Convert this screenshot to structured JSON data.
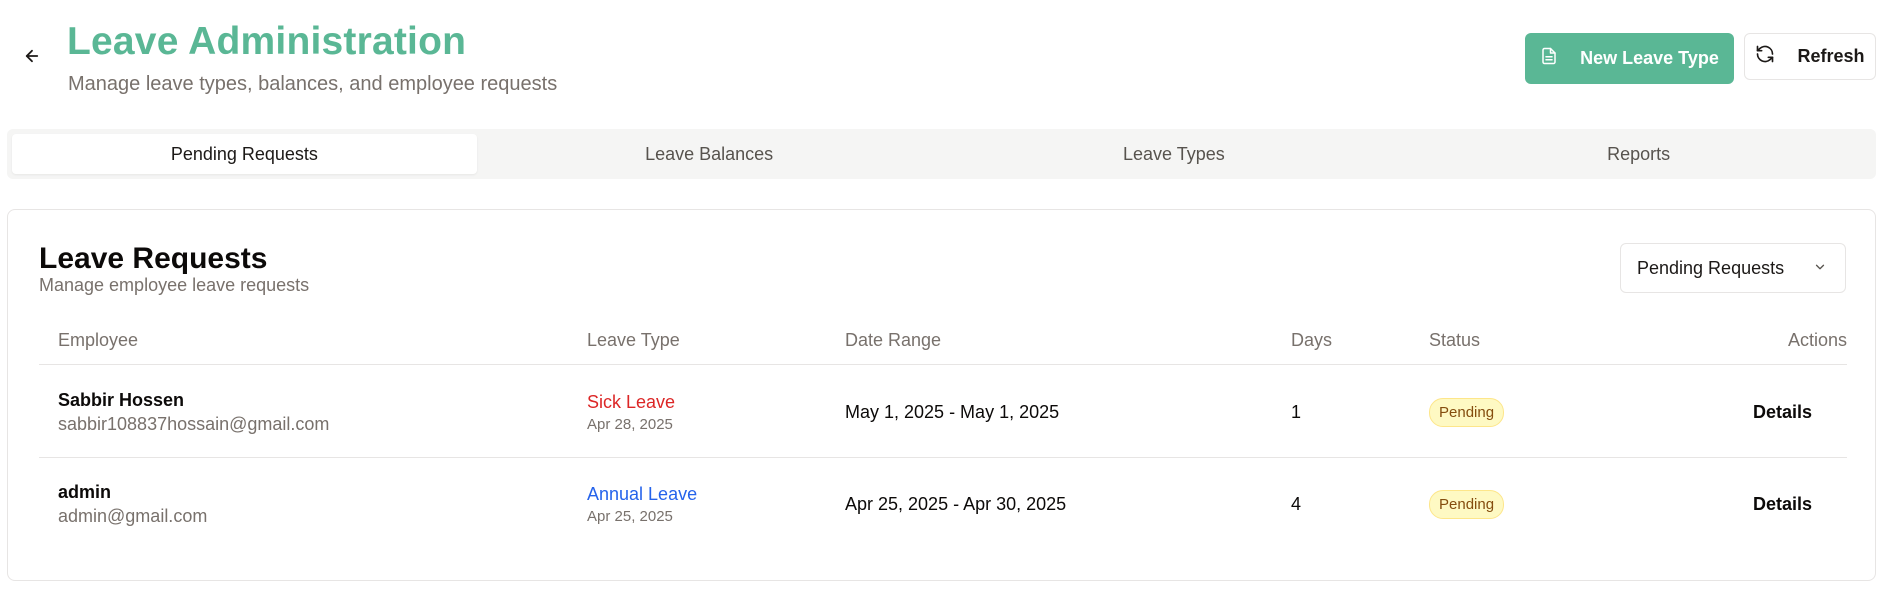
{
  "header": {
    "title": "Leave Administration",
    "subtitle": "Manage leave types, balances, and employee requests",
    "new_button_label": "New Leave Type",
    "refresh_button_label": "Refresh",
    "accent_color": "#5ab795"
  },
  "tabs": [
    {
      "label": "Pending Requests",
      "active": true
    },
    {
      "label": "Leave Balances",
      "active": false
    },
    {
      "label": "Leave Types",
      "active": false
    },
    {
      "label": "Reports",
      "active": false
    }
  ],
  "card": {
    "title": "Leave Requests",
    "subtitle": "Manage employee leave requests",
    "filter_value": "Pending Requests"
  },
  "table": {
    "columns": [
      "Employee",
      "Leave Type",
      "Date Range",
      "Days",
      "Status",
      "Actions"
    ],
    "rows": [
      {
        "name": "Sabbir Hossen",
        "email": "sabbir108837hossain@gmail.com",
        "leave_type": "Sick Leave",
        "leave_type_color": "#dc2626",
        "requested_on": "Apr 28, 2025",
        "date_range": "May 1, 2025 - May 1, 2025",
        "days": "1",
        "status": "Pending",
        "action": "Details"
      },
      {
        "name": "admin",
        "email": "admin@gmail.com",
        "leave_type": "Annual Leave",
        "leave_type_color": "#2563eb",
        "requested_on": "Apr 25, 2025",
        "date_range": "Apr 25, 2025 - Apr 30, 2025",
        "days": "4",
        "status": "Pending",
        "action": "Details"
      }
    ]
  },
  "icons": {
    "back": "arrow-left-icon",
    "new": "file-icon",
    "refresh": "refresh-icon",
    "select": "chevron-down-icon"
  }
}
